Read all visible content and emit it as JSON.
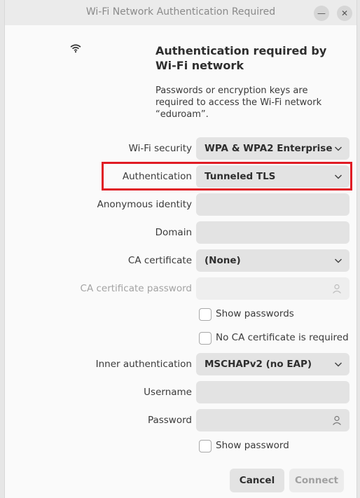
{
  "window": {
    "title": "Wi-Fi Network Authentication Required",
    "minimize_glyph": "—",
    "close_glyph": "✕"
  },
  "icons": {
    "network": "wifi-icon",
    "dropdown": "chevron-down-icon",
    "password_storage": "person-icon"
  },
  "heading": "Authentication required by Wi-Fi network",
  "description": "Passwords or encryption keys are required to access the Wi-Fi network “eduroam”.",
  "form": {
    "wifi_security": {
      "label": "Wi-Fi security",
      "value": "WPA & WPA2 Enterprise"
    },
    "authentication": {
      "label": "Authentication",
      "value": "Tunneled TLS"
    },
    "anonymous_identity": {
      "label": "Anonymous identity",
      "value": ""
    },
    "domain": {
      "label": "Domain",
      "value": ""
    },
    "ca_certificate": {
      "label": "CA certificate",
      "value": "(None)"
    },
    "ca_certificate_password": {
      "label": "CA certificate password",
      "value": "",
      "disabled": true
    },
    "show_passwords": {
      "label": "Show passwords",
      "checked": false
    },
    "no_ca_cert": {
      "label": "No CA certificate is required",
      "checked": false
    },
    "inner_authentication": {
      "label": "Inner authentication",
      "value": "MSCHAPv2 (no EAP)"
    },
    "username": {
      "label": "Username",
      "value": ""
    },
    "password": {
      "label": "Password",
      "value": ""
    },
    "show_password": {
      "label": "Show password",
      "checked": false
    }
  },
  "buttons": {
    "cancel": "Cancel",
    "connect": "Connect"
  },
  "colors": {
    "highlight": "#e01b24",
    "window_bg": "#fafafa",
    "field_bg": "#e3e3e3"
  }
}
